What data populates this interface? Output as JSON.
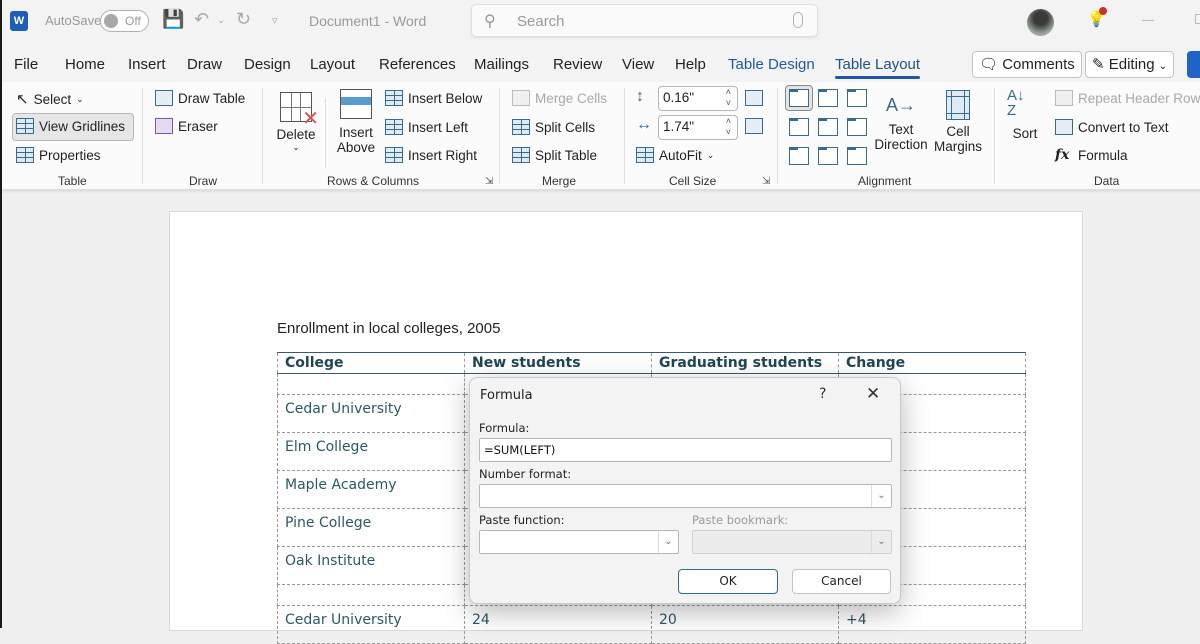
{
  "titlebar": {
    "app_icon": "word-logo-icon",
    "app_letter": "W",
    "autosave_label": "AutoSave",
    "autosave_state": "Off",
    "document_title": "Document1  -  Word",
    "search_placeholder": "Search"
  },
  "tabs": [
    {
      "label": "File"
    },
    {
      "label": "Home"
    },
    {
      "label": "Insert"
    },
    {
      "label": "Draw"
    },
    {
      "label": "Design"
    },
    {
      "label": "Layout"
    },
    {
      "label": "References"
    },
    {
      "label": "Mailings"
    },
    {
      "label": "Review"
    },
    {
      "label": "View"
    },
    {
      "label": "Help"
    },
    {
      "label": "Table Design"
    },
    {
      "label": "Table Layout"
    }
  ],
  "active_tab": "Table Layout",
  "header_buttons": {
    "comments": "Comments",
    "editing": "Editing"
  },
  "ribbon": {
    "table": {
      "label": "Table",
      "select": "Select",
      "view_gridlines": "View Gridlines",
      "properties": "Properties"
    },
    "draw": {
      "label": "Draw",
      "draw_table": "Draw Table",
      "eraser": "Eraser"
    },
    "rows_columns": {
      "label": "Rows & Columns",
      "delete": "Delete",
      "insert_above_1": "Insert",
      "insert_above_2": "Above",
      "insert_below": "Insert Below",
      "insert_left": "Insert Left",
      "insert_right": "Insert Right"
    },
    "merge": {
      "label": "Merge",
      "merge_cells": "Merge Cells",
      "split_cells": "Split Cells",
      "split_table": "Split Table"
    },
    "cell_size": {
      "label": "Cell Size",
      "height": "0.16\"",
      "width": "1.74\"",
      "autofit": "AutoFit"
    },
    "alignment": {
      "label": "Alignment",
      "text_direction_1": "Text",
      "text_direction_2": "Direction",
      "cell_margins_1": "Cell",
      "cell_margins_2": "Margins"
    },
    "data": {
      "label": "Data",
      "sort": "Sort",
      "repeat_header_rows": "Repeat Header Rows",
      "convert_to_text": "Convert to Text",
      "formula": "Formula"
    }
  },
  "document": {
    "caption": "Enrollment in local colleges, 2005",
    "table": {
      "headers": [
        "College",
        "New students",
        "Graduating students",
        "Change"
      ],
      "rows": [
        [
          "",
          "",
          "",
          ""
        ],
        [
          "Cedar University",
          "",
          "",
          ""
        ],
        [
          "Elm College",
          "",
          "",
          ""
        ],
        [
          "Maple Academy",
          "",
          "",
          ""
        ],
        [
          "Pine College",
          "",
          "",
          ""
        ],
        [
          "Oak Institute",
          "",
          "",
          ""
        ],
        [
          "",
          "",
          "",
          ""
        ],
        [
          "Cedar University",
          "24",
          "20",
          "+4"
        ]
      ]
    }
  },
  "formula_dialog": {
    "title": "Formula",
    "help": "?",
    "formula_label": "Formula:",
    "formula_value": "=SUM(LEFT)",
    "number_format_label": "Number format:",
    "number_format_value": "",
    "paste_function_label": "Paste function:",
    "paste_bookmark_label": "Paste bookmark:",
    "ok": "OK",
    "cancel": "Cancel"
  }
}
